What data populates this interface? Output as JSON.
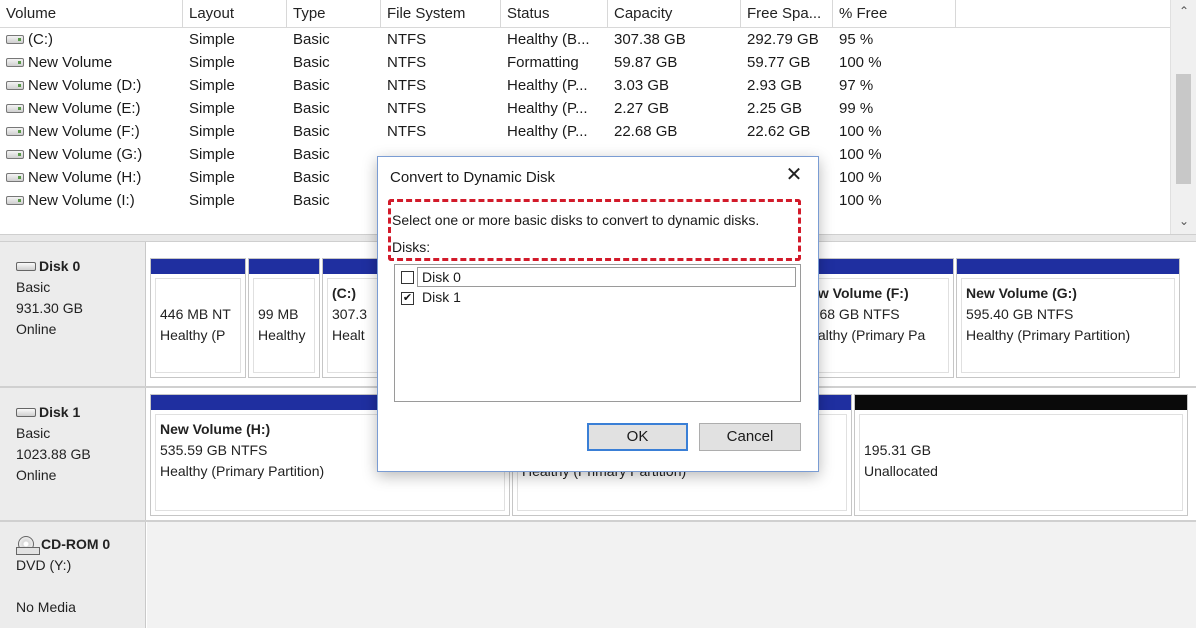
{
  "columns": [
    "Volume",
    "Layout",
    "Type",
    "File System",
    "Status",
    "Capacity",
    "Free Spa...",
    "% Free"
  ],
  "volumes": [
    {
      "name": "(C:)",
      "layout": "Simple",
      "type": "Basic",
      "fs": "NTFS",
      "status": "Healthy (B...",
      "capacity": "307.38 GB",
      "free": "292.79 GB",
      "pct": "95 %"
    },
    {
      "name": "New Volume",
      "layout": "Simple",
      "type": "Basic",
      "fs": "NTFS",
      "status": "Formatting",
      "capacity": "59.87 GB",
      "free": "59.77 GB",
      "pct": "100 %"
    },
    {
      "name": "New Volume (D:)",
      "layout": "Simple",
      "type": "Basic",
      "fs": "NTFS",
      "status": "Healthy (P...",
      "capacity": "3.03 GB",
      "free": "2.93 GB",
      "pct": "97 %"
    },
    {
      "name": "New Volume (E:)",
      "layout": "Simple",
      "type": "Basic",
      "fs": "NTFS",
      "status": "Healthy (P...",
      "capacity": "2.27 GB",
      "free": "2.25 GB",
      "pct": "99 %"
    },
    {
      "name": "New Volume (F:)",
      "layout": "Simple",
      "type": "Basic",
      "fs": "NTFS",
      "status": "Healthy (P...",
      "capacity": "22.68 GB",
      "free": "22.62 GB",
      "pct": "100 %"
    },
    {
      "name": "New Volume (G:)",
      "layout": "Simple",
      "type": "Basic",
      "fs": "",
      "status": "",
      "capacity": "",
      "free": "",
      "pct": "100 %"
    },
    {
      "name": "New Volume (H:)",
      "layout": "Simple",
      "type": "Basic",
      "fs": "",
      "status": "",
      "capacity": "",
      "free": "",
      "pct": "100 %"
    },
    {
      "name": "New Volume (I:)",
      "layout": "Simple",
      "type": "Basic",
      "fs": "",
      "status": "",
      "capacity": "",
      "free": "",
      "pct": "100 %"
    }
  ],
  "scrollbar": {
    "up_arrow": "⌃",
    "down_arrow": "⌄"
  },
  "disks": {
    "disk0": {
      "name": "Disk 0",
      "type": "Basic",
      "size": "931.30 GB",
      "state": "Online",
      "partitions": [
        {
          "title": "",
          "size": "446 MB NT",
          "status": "Healthy (P"
        },
        {
          "title": "",
          "size": "99 MB",
          "status": "Healthy"
        },
        {
          "title": "(C:)",
          "size": "307.3",
          "status": "Healt"
        },
        {
          "title": "New Volume (F:)",
          "size": "22.68 GB NTFS",
          "status": "Healthy (Primary Pa"
        },
        {
          "title": "New Volume (G:)",
          "size": "595.40 GB NTFS",
          "status": "Healthy (Primary Partition)"
        }
      ]
    },
    "disk1": {
      "name": "Disk 1",
      "type": "Basic",
      "size": "1023.88 GB",
      "state": "Online",
      "partitions": [
        {
          "title": "New Volume (H:)",
          "size": "535.59 GB NTFS",
          "status": "Healthy (Primary Partition)"
        },
        {
          "title": "",
          "size": "",
          "status": "Healthy (Primary Partition)"
        },
        {
          "title": "",
          "size": "195.31 GB",
          "status": "Unallocated"
        }
      ]
    },
    "cdrom": {
      "name": "CD-ROM 0",
      "type": "DVD (Y:)",
      "state": "No Media"
    }
  },
  "dialog": {
    "title": "Convert to Dynamic Disk",
    "close": "✕",
    "instruction": "Select one or more basic disks to convert to dynamic disks.",
    "disks_label": "Disks:",
    "list": [
      {
        "label": "Disk 0",
        "checked": false,
        "mark": ""
      },
      {
        "label": "Disk 1",
        "checked": true,
        "mark": "✔"
      }
    ],
    "ok": "OK",
    "cancel": "Cancel"
  },
  "colors": {
    "partition_bar": "#1f2fa0",
    "unallocated_bar": "#0a0a0a",
    "highlight": "#d21a2a",
    "ok_border": "#3a7fd6"
  }
}
